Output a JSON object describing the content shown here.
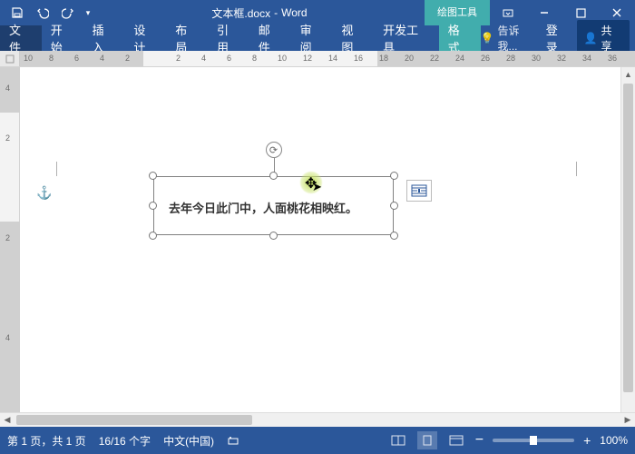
{
  "title": {
    "doc": "文本框.docx",
    "app": "Word",
    "context": "绘图工具"
  },
  "qat": {
    "save": "保存",
    "undo": "撤消",
    "redo": "恢复"
  },
  "tabs": {
    "file": "文件",
    "home": "开始",
    "insert": "插入",
    "design": "设计",
    "layout": "布局",
    "references": "引用",
    "mailings": "邮件",
    "review": "审阅",
    "view": "视图",
    "developer": "开发工具",
    "format": "格式"
  },
  "ribbon_right": {
    "tell_me": "告诉我...",
    "signin": "登录",
    "share": "共享"
  },
  "ruler_h": [
    "10",
    "8",
    "6",
    "4",
    "2",
    "",
    "2",
    "4",
    "6",
    "8",
    "10",
    "12",
    "14",
    "16",
    "18",
    "20",
    "22",
    "24",
    "26",
    "28",
    "30",
    "32",
    "34",
    "36"
  ],
  "ruler_v": [
    "4",
    "2",
    "",
    "2",
    "",
    "4"
  ],
  "textbox": {
    "content": "去年今日此门中，人面桃花相映红。"
  },
  "status": {
    "page": "第 1 页，共 1 页",
    "words": "16/16 个字",
    "lang": "中文(中国)",
    "zoom": "100%"
  },
  "zoom_controls": {
    "minus": "−",
    "plus": "+"
  }
}
